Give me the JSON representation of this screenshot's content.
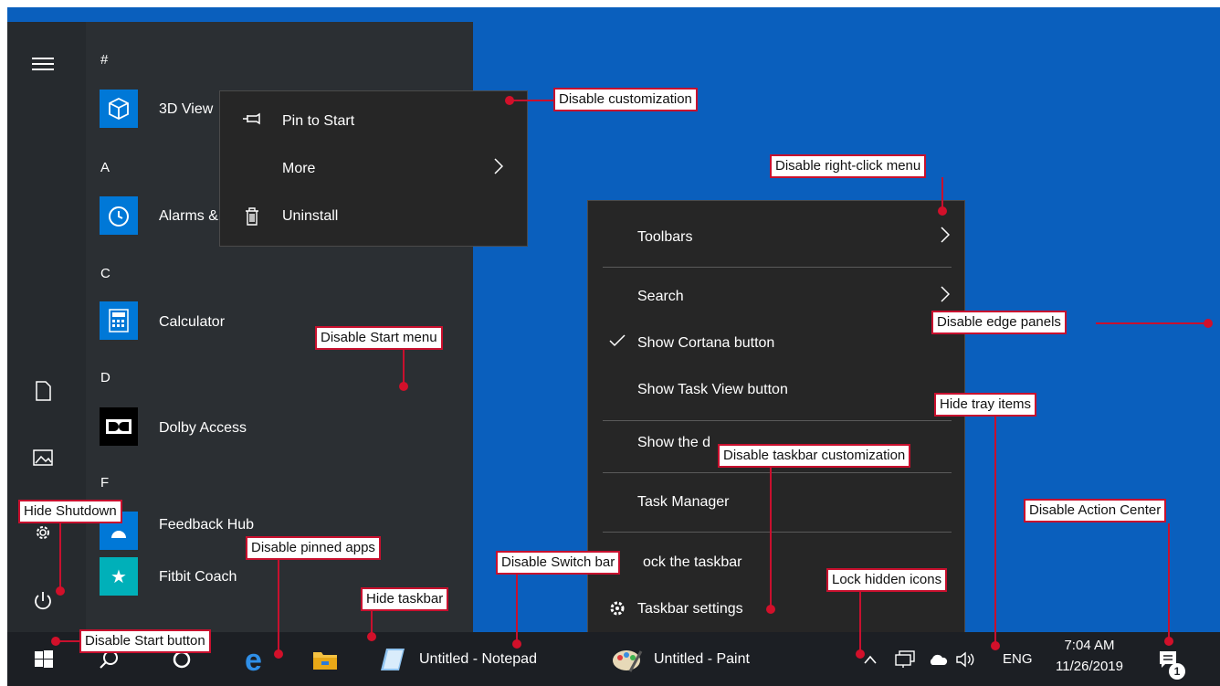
{
  "start_menu": {
    "letters": [
      "#",
      "A",
      "C",
      "D",
      "F"
    ],
    "apps": [
      {
        "name": "3D View",
        "tile_color": "#0078d7",
        "icon": "cube-icon"
      },
      {
        "name": "Alarms &",
        "tile_color": "#0078d7",
        "icon": "alarm-clock-icon"
      },
      {
        "name": "Calculator",
        "tile_color": "#0078d7",
        "icon": "calculator-icon"
      },
      {
        "name": "Dolby Access",
        "tile_color": "#000000",
        "icon": "dolby-icon"
      },
      {
        "name": "Feedback Hub",
        "tile_color": "#0078d7",
        "icon": "feedback-icon"
      },
      {
        "name": "Fitbit Coach",
        "tile_color": "#00b0b9",
        "icon": "star-icon"
      }
    ],
    "rail_icons": [
      "hamburger-icon",
      "document-icon",
      "pictures-icon",
      "settings-icon",
      "power-icon"
    ]
  },
  "app_context_menu": {
    "items": [
      {
        "label": "Pin to Start",
        "icon": "pin-icon"
      },
      {
        "label": "More",
        "icon": "",
        "submenu": true
      },
      {
        "label": "Uninstall",
        "icon": "trash-icon"
      }
    ]
  },
  "taskbar_context_menu": {
    "items": [
      {
        "label": "Toolbars",
        "submenu": true
      },
      {
        "label": "Search",
        "submenu": true
      },
      {
        "label": "Show Cortana button",
        "checked": true
      },
      {
        "label": "Show Task View button"
      },
      {
        "label": "Show the d"
      },
      {
        "label": "Task Manager"
      },
      {
        "label": "ock the taskbar"
      },
      {
        "label": "Taskbar settings",
        "icon": "gear-icon"
      }
    ]
  },
  "taskbar": {
    "apps": [
      {
        "label": "Untitled - Notepad",
        "icon": "notepad-icon"
      },
      {
        "label": "Untitled - Paint",
        "icon": "paint-icon"
      }
    ],
    "language": "ENG",
    "time": "7:04 AM",
    "date": "11/26/2019",
    "notification_count": "1"
  },
  "callouts": {
    "disable_customization": "Disable customization",
    "disable_right_click": "Disable right-click menu",
    "disable_start_menu": "Disable Start menu",
    "disable_edge_panels": "Disable edge panels",
    "hide_tray_items": "Hide tray items",
    "disable_taskbar_customization": "Disable taskbar customization",
    "hide_shutdown": "Hide Shutdown",
    "disable_action_center": "Disable Action Center",
    "disable_pinned_apps": "Disable pinned apps",
    "disable_switch_bar": "Disable Switch bar",
    "lock_hidden_icons": "Lock hidden icons",
    "hide_taskbar": "Hide taskbar",
    "disable_start_button": "Disable Start button"
  },
  "colors": {
    "desktop": "#0a5fbd",
    "callout_border": "#c8102e",
    "start_bg": "#2b2f33",
    "menu_bg": "#262626"
  }
}
